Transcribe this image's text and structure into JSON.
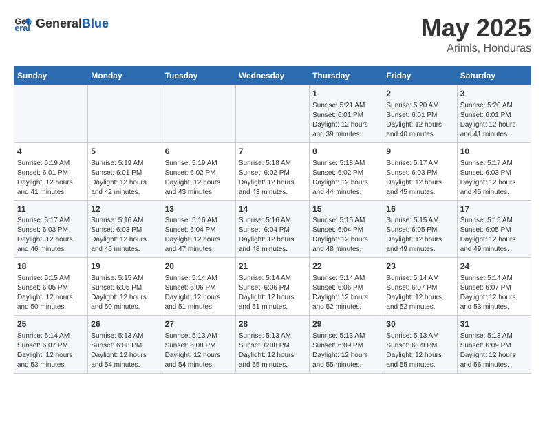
{
  "header": {
    "logo_general": "General",
    "logo_blue": "Blue",
    "main_title": "May 2025",
    "subtitle": "Arimis, Honduras"
  },
  "weekdays": [
    "Sunday",
    "Monday",
    "Tuesday",
    "Wednesday",
    "Thursday",
    "Friday",
    "Saturday"
  ],
  "weeks": [
    [
      {
        "day": "",
        "info": ""
      },
      {
        "day": "",
        "info": ""
      },
      {
        "day": "",
        "info": ""
      },
      {
        "day": "",
        "info": ""
      },
      {
        "day": "1",
        "info": "Sunrise: 5:21 AM\nSunset: 6:01 PM\nDaylight: 12 hours\nand 39 minutes."
      },
      {
        "day": "2",
        "info": "Sunrise: 5:20 AM\nSunset: 6:01 PM\nDaylight: 12 hours\nand 40 minutes."
      },
      {
        "day": "3",
        "info": "Sunrise: 5:20 AM\nSunset: 6:01 PM\nDaylight: 12 hours\nand 41 minutes."
      }
    ],
    [
      {
        "day": "4",
        "info": "Sunrise: 5:19 AM\nSunset: 6:01 PM\nDaylight: 12 hours\nand 41 minutes."
      },
      {
        "day": "5",
        "info": "Sunrise: 5:19 AM\nSunset: 6:01 PM\nDaylight: 12 hours\nand 42 minutes."
      },
      {
        "day": "6",
        "info": "Sunrise: 5:19 AM\nSunset: 6:02 PM\nDaylight: 12 hours\nand 43 minutes."
      },
      {
        "day": "7",
        "info": "Sunrise: 5:18 AM\nSunset: 6:02 PM\nDaylight: 12 hours\nand 43 minutes."
      },
      {
        "day": "8",
        "info": "Sunrise: 5:18 AM\nSunset: 6:02 PM\nDaylight: 12 hours\nand 44 minutes."
      },
      {
        "day": "9",
        "info": "Sunrise: 5:17 AM\nSunset: 6:03 PM\nDaylight: 12 hours\nand 45 minutes."
      },
      {
        "day": "10",
        "info": "Sunrise: 5:17 AM\nSunset: 6:03 PM\nDaylight: 12 hours\nand 45 minutes."
      }
    ],
    [
      {
        "day": "11",
        "info": "Sunrise: 5:17 AM\nSunset: 6:03 PM\nDaylight: 12 hours\nand 46 minutes."
      },
      {
        "day": "12",
        "info": "Sunrise: 5:16 AM\nSunset: 6:03 PM\nDaylight: 12 hours\nand 46 minutes."
      },
      {
        "day": "13",
        "info": "Sunrise: 5:16 AM\nSunset: 6:04 PM\nDaylight: 12 hours\nand 47 minutes."
      },
      {
        "day": "14",
        "info": "Sunrise: 5:16 AM\nSunset: 6:04 PM\nDaylight: 12 hours\nand 48 minutes."
      },
      {
        "day": "15",
        "info": "Sunrise: 5:15 AM\nSunset: 6:04 PM\nDaylight: 12 hours\nand 48 minutes."
      },
      {
        "day": "16",
        "info": "Sunrise: 5:15 AM\nSunset: 6:05 PM\nDaylight: 12 hours\nand 49 minutes."
      },
      {
        "day": "17",
        "info": "Sunrise: 5:15 AM\nSunset: 6:05 PM\nDaylight: 12 hours\nand 49 minutes."
      }
    ],
    [
      {
        "day": "18",
        "info": "Sunrise: 5:15 AM\nSunset: 6:05 PM\nDaylight: 12 hours\nand 50 minutes."
      },
      {
        "day": "19",
        "info": "Sunrise: 5:15 AM\nSunset: 6:05 PM\nDaylight: 12 hours\nand 50 minutes."
      },
      {
        "day": "20",
        "info": "Sunrise: 5:14 AM\nSunset: 6:06 PM\nDaylight: 12 hours\nand 51 minutes."
      },
      {
        "day": "21",
        "info": "Sunrise: 5:14 AM\nSunset: 6:06 PM\nDaylight: 12 hours\nand 51 minutes."
      },
      {
        "day": "22",
        "info": "Sunrise: 5:14 AM\nSunset: 6:06 PM\nDaylight: 12 hours\nand 52 minutes."
      },
      {
        "day": "23",
        "info": "Sunrise: 5:14 AM\nSunset: 6:07 PM\nDaylight: 12 hours\nand 52 minutes."
      },
      {
        "day": "24",
        "info": "Sunrise: 5:14 AM\nSunset: 6:07 PM\nDaylight: 12 hours\nand 53 minutes."
      }
    ],
    [
      {
        "day": "25",
        "info": "Sunrise: 5:14 AM\nSunset: 6:07 PM\nDaylight: 12 hours\nand 53 minutes."
      },
      {
        "day": "26",
        "info": "Sunrise: 5:13 AM\nSunset: 6:08 PM\nDaylight: 12 hours\nand 54 minutes."
      },
      {
        "day": "27",
        "info": "Sunrise: 5:13 AM\nSunset: 6:08 PM\nDaylight: 12 hours\nand 54 minutes."
      },
      {
        "day": "28",
        "info": "Sunrise: 5:13 AM\nSunset: 6:08 PM\nDaylight: 12 hours\nand 55 minutes."
      },
      {
        "day": "29",
        "info": "Sunrise: 5:13 AM\nSunset: 6:09 PM\nDaylight: 12 hours\nand 55 minutes."
      },
      {
        "day": "30",
        "info": "Sunrise: 5:13 AM\nSunset: 6:09 PM\nDaylight: 12 hours\nand 55 minutes."
      },
      {
        "day": "31",
        "info": "Sunrise: 5:13 AM\nSunset: 6:09 PM\nDaylight: 12 hours\nand 56 minutes."
      }
    ]
  ]
}
